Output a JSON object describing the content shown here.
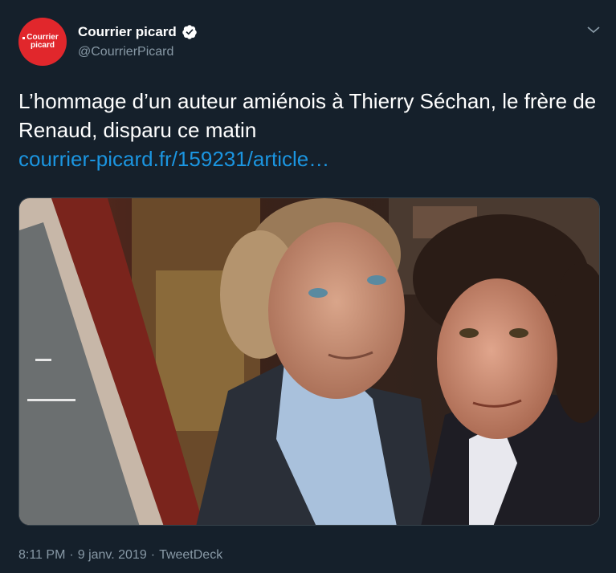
{
  "author": {
    "display_name": "Courrier picard",
    "handle": "@CourrierPicard",
    "avatar_line1": "Courrier",
    "avatar_line2": "picard",
    "verified_icon": "verified-badge-icon"
  },
  "menu": {
    "icon": "chevron-down-icon"
  },
  "tweet": {
    "text": "L’hommage d’un auteur amiénois à Thierry Séchan, le frère de Renaud, disparu ce matin",
    "link_text": "courrier-picard.fr/159231/article…"
  },
  "meta": {
    "time": "8:11 PM",
    "sep1": "·",
    "date": "9 janv. 2019",
    "sep2": "·",
    "source": "TweetDeck"
  },
  "colors": {
    "background": "#15202b",
    "text_primary": "#ffffff",
    "text_secondary": "#8899a6",
    "link": "#1b95e0",
    "brand_red": "#e1272c"
  }
}
